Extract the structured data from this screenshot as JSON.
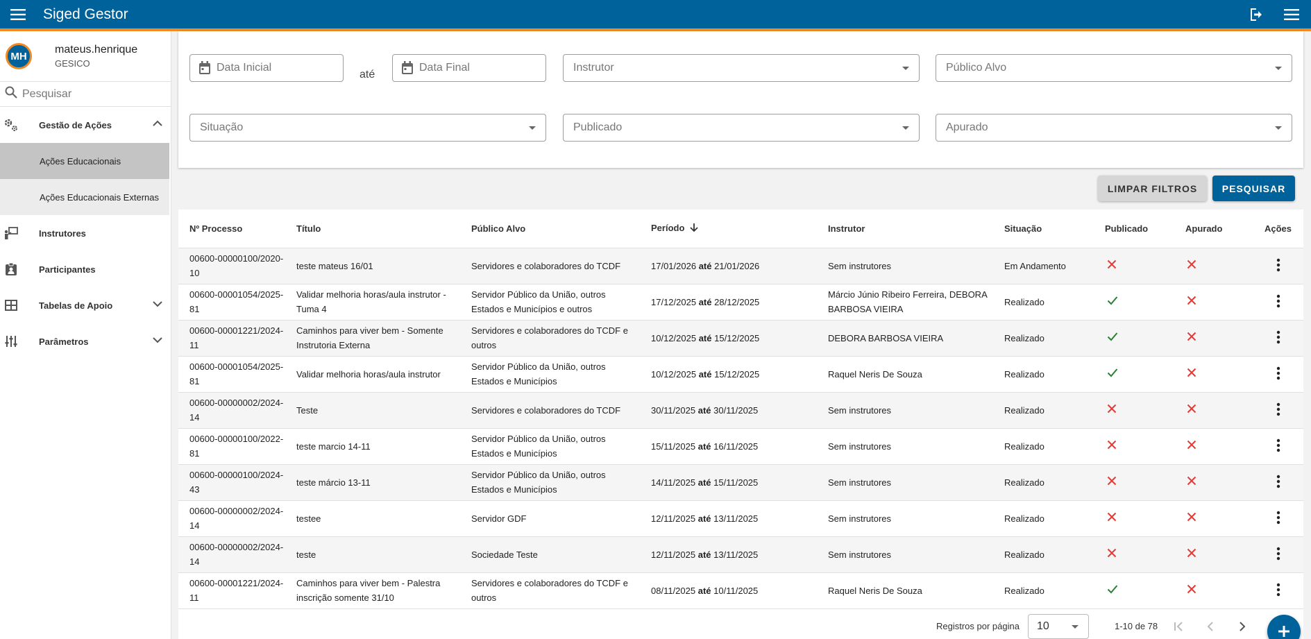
{
  "app": {
    "title": "Siged Gestor"
  },
  "user": {
    "initials": "MH",
    "name": "mateus.henrique",
    "org": "GESICO"
  },
  "sidebar": {
    "search_placeholder": "Pesquisar",
    "items": [
      {
        "label": "Gestão de Ações",
        "icon": "gears-icon",
        "expanded": true
      },
      {
        "label": "Instrutores",
        "icon": "instructor-icon"
      },
      {
        "label": "Participantes",
        "icon": "badge-icon"
      },
      {
        "label": "Tabelas de Apoio",
        "icon": "table-icon",
        "expanded": false
      },
      {
        "label": "Parâmetros",
        "icon": "sliders-icon",
        "expanded": false
      }
    ],
    "subitems": [
      {
        "label": "Ações Educacionais",
        "active": true
      },
      {
        "label": "Ações Educacionais Externas",
        "active": false
      }
    ]
  },
  "filters": {
    "data_inicial": "Data Inicial",
    "ate": "até",
    "data_final": "Data Final",
    "instrutor": "Instrutor",
    "publico_alvo": "Público Alvo",
    "situacao": "Situação",
    "publicado": "Publicado",
    "apurado": "Apurado"
  },
  "buttons": {
    "clear": "LIMPAR FILTROS",
    "search": "PESQUISAR"
  },
  "table": {
    "headers": [
      "Nº Processo",
      "Título",
      "Público Alvo",
      "Período",
      "Instrutor",
      "Situação",
      "Publicado",
      "Apurado",
      "Ações"
    ],
    "period_separator": "até",
    "rows": [
      {
        "processo": "00600-00000100/2020-10",
        "titulo": "teste mateus 16/01",
        "publico": "Servidores e colaboradores do TCDF",
        "inicio": "17/01/2026",
        "fim": "21/01/2026",
        "instrutor": "Sem instrutores",
        "situacao": "Em Andamento",
        "publicado": false,
        "apurado": false
      },
      {
        "processo": "00600-00001054/2025-81",
        "titulo": "Validar melhoria horas/aula instrutor - Tuma 4",
        "publico": "Servidor Público da União, outros Estados e Municípios e outros",
        "inicio": "17/12/2025",
        "fim": "28/12/2025",
        "instrutor": "Márcio Júnio Ribeiro Ferreira, DEBORA BARBOSA VIEIRA",
        "situacao": "Realizado",
        "publicado": true,
        "apurado": false
      },
      {
        "processo": "00600-00001221/2024-11",
        "titulo": "Caminhos para viver bem - Somente Instrutoria Externa",
        "publico": "Servidores e colaboradores do TCDF e outros",
        "inicio": "10/12/2025",
        "fim": "15/12/2025",
        "instrutor": "DEBORA BARBOSA VIEIRA",
        "situacao": "Realizado",
        "publicado": true,
        "apurado": false
      },
      {
        "processo": "00600-00001054/2025-81",
        "titulo": "Validar melhoria horas/aula instrutor",
        "publico": "Servidor Público da União, outros Estados e Municípios",
        "inicio": "10/12/2025",
        "fim": "15/12/2025",
        "instrutor": "Raquel Neris De Souza",
        "situacao": "Realizado",
        "publicado": true,
        "apurado": false
      },
      {
        "processo": "00600-00000002/2024-14",
        "titulo": "Teste",
        "publico": "Servidores e colaboradores do TCDF",
        "inicio": "30/11/2025",
        "fim": "30/11/2025",
        "instrutor": "Sem instrutores",
        "situacao": "Realizado",
        "publicado": false,
        "apurado": false
      },
      {
        "processo": "00600-00000100/2022-81",
        "titulo": "teste marcio 14-11",
        "publico": "Servidor Público da União, outros Estados e Municípios",
        "inicio": "15/11/2025",
        "fim": "16/11/2025",
        "instrutor": "Sem instrutores",
        "situacao": "Realizado",
        "publicado": false,
        "apurado": false
      },
      {
        "processo": "00600-00000100/2024-43",
        "titulo": "teste márcio 13-11",
        "publico": "Servidor Público da União, outros Estados e Municípios",
        "inicio": "14/11/2025",
        "fim": "15/11/2025",
        "instrutor": "Sem instrutores",
        "situacao": "Realizado",
        "publicado": false,
        "apurado": false
      },
      {
        "processo": "00600-00000002/2024-14",
        "titulo": "testee",
        "publico": "Servidor GDF",
        "inicio": "12/11/2025",
        "fim": "13/11/2025",
        "instrutor": "Sem instrutores",
        "situacao": "Realizado",
        "publicado": false,
        "apurado": false
      },
      {
        "processo": "00600-00000002/2024-14",
        "titulo": "teste",
        "publico": "Sociedade Teste",
        "inicio": "12/11/2025",
        "fim": "13/11/2025",
        "instrutor": "Sem instrutores",
        "situacao": "Realizado",
        "publicado": false,
        "apurado": false
      },
      {
        "processo": "00600-00001221/2024-11",
        "titulo": "Caminhos para viver bem - Palestra inscrição somente 31/10",
        "publico": "Servidores e colaboradores do TCDF e outros",
        "inicio": "08/11/2025",
        "fim": "10/11/2025",
        "instrutor": "Raquel Neris De Souza",
        "situacao": "Realizado",
        "publicado": true,
        "apurado": false
      }
    ]
  },
  "pagination": {
    "rows_label": "Registros por página",
    "rows_value": "10",
    "range": "1-10 de 78"
  },
  "colors": {
    "primary": "#00629b",
    "accent": "#f08a24",
    "check": "#2e7d32",
    "cross": "#e53935"
  }
}
